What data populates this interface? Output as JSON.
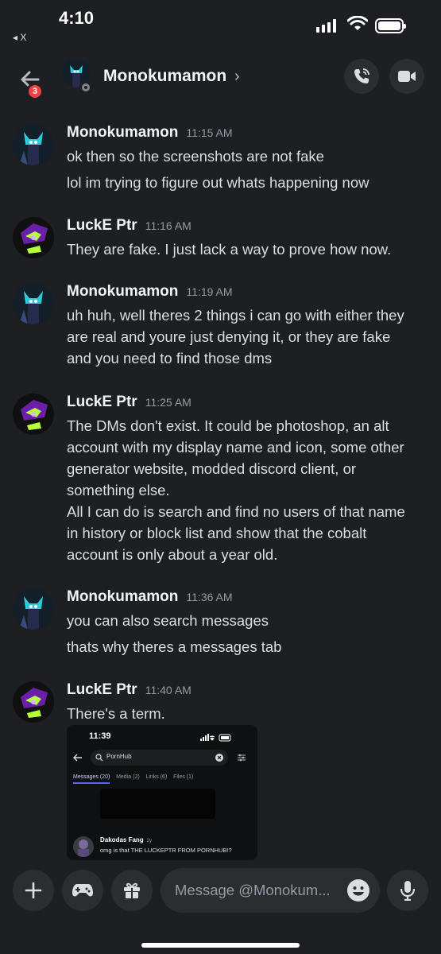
{
  "status_bar": {
    "time": "4:10",
    "back_app": "◂ X"
  },
  "header": {
    "unread_badge": "3",
    "name": "Monokumamon",
    "chevron": "›",
    "icons": {
      "back": "arrow-left-icon",
      "call": "phone-icon",
      "video": "video-camera-icon"
    }
  },
  "messages": [
    {
      "author": "Monokumamon",
      "time": "11:15 AM",
      "lines": [
        "ok then so the screenshots are not fake",
        "lol im trying to figure out whats happening now"
      ]
    },
    {
      "author": "LuckE Ptr",
      "time": "11:16 AM",
      "lines": [
        "They are fake. I just lack a way to prove how now."
      ]
    },
    {
      "author": "Monokumamon",
      "time": "11:19 AM",
      "lines": [
        "uh huh, well theres 2 things i can go with either they",
        "are real and youre just denying it, or they are fake",
        "and you need to find those dms"
      ]
    },
    {
      "author": "LuckE Ptr",
      "time": "11:25 AM",
      "lines": [
        "The DMs don't exist. It could be photoshop, an alt",
        "account with my display name and icon, some other",
        "generator website, modded discord client, or",
        "something else.",
        "All I can do is search and find no users of that name",
        "in history or block list and show that the cobalt",
        "account is only about a year old."
      ]
    },
    {
      "author": "Monokumamon",
      "time": "11:36 AM",
      "lines": [
        "you can also search messages",
        "thats why theres a messages tab"
      ]
    },
    {
      "author": "LuckE Ptr",
      "time": "11:40 AM",
      "lines": [
        "There's a term."
      ]
    }
  ],
  "embed": {
    "time": "11:39",
    "search_value": "PornHub",
    "tabs": [
      "Messages (20)",
      "Media (2)",
      "Links (6)",
      "Files (1)"
    ],
    "result_author": "Dakodas Fang",
    "result_age": "2y",
    "result_text": "omg is that THE LUCKEPTR FROM PORNHUB!?"
  },
  "composer": {
    "placeholder": "Message @Monokum...",
    "icons": [
      "plus-icon",
      "gamepad-icon",
      "gift-icon",
      "emoji-icon",
      "microphone-icon"
    ]
  },
  "colors": {
    "background": "#1e1f22",
    "surface": "#2b2d31",
    "text": "#dbdee1",
    "muted": "#949ba4",
    "badge": "#f23f43"
  }
}
